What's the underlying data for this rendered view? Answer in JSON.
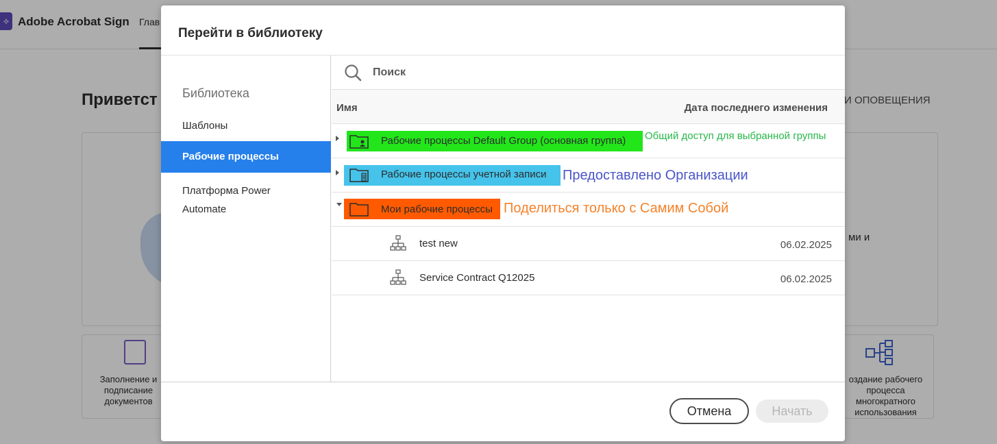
{
  "app": {
    "brand": "Adobe Acrobat Sign",
    "nav_home": "Глав",
    "welcome": "Приветст",
    "alerts_tab": "И ОПОВЕЩЕНИЯ",
    "right_card_text": "ми и",
    "left_tile_text": "Заполнение и подписание документов",
    "right_tile_text": "оздание рабочего процесса многократного использования"
  },
  "dialog": {
    "title": "Перейти в библиотеку",
    "sidebar": {
      "heading": "Библиотека",
      "items": [
        {
          "label": "Шаблоны"
        },
        {
          "label": "Рабочие процессы"
        },
        {
          "label": "Платформа Power Automate"
        }
      ]
    },
    "search": {
      "placeholder": "Поиск"
    },
    "columns": {
      "name": "Имя",
      "date": "Дата последнего изменения"
    },
    "folders": [
      {
        "label": "Рабочие процессы Default Group (основная группа)",
        "note": "Общий доступ для выбранной группы",
        "highlight": "#22e61a",
        "note_color": "#27b84a"
      },
      {
        "label": "Рабочие процессы учетной записи",
        "note": "Предоставлено Организации",
        "highlight": "#45c3ea",
        "note_color": "#4a55c8"
      },
      {
        "label": "Мои рабочие процессы",
        "note": "Поделиться только с Самим Собой",
        "highlight": "#ff5a00",
        "note_color": "#f5822a"
      }
    ],
    "workflows": [
      {
        "name": "test new",
        "date": "06.02.2025"
      },
      {
        "name": "Service Contract Q12025",
        "date": "06.02.2025"
      }
    ],
    "buttons": {
      "cancel": "Отмена",
      "start": "Начать"
    }
  }
}
